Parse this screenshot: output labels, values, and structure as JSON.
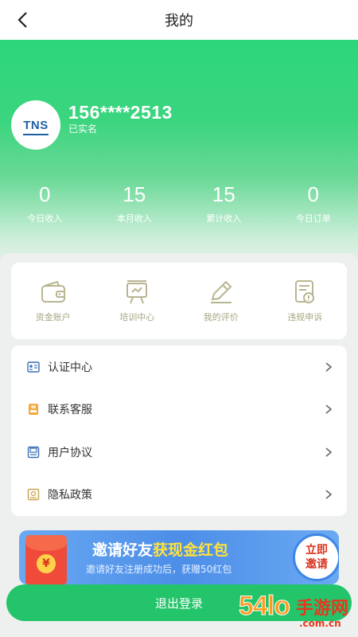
{
  "header": {
    "title": "我的",
    "back_icon": "chevron-left-icon"
  },
  "profile": {
    "avatar_logo": "TNS",
    "phone": "156****2513",
    "status": "已实名"
  },
  "stats": [
    {
      "value": "0",
      "label": "今日收入"
    },
    {
      "value": "15",
      "label": "本月收入"
    },
    {
      "value": "15",
      "label": "累计收入"
    },
    {
      "value": "0",
      "label": "今日订单"
    }
  ],
  "quick_actions": [
    {
      "label": "资金账户",
      "icon": "wallet-icon"
    },
    {
      "label": "培训中心",
      "icon": "easel-icon"
    },
    {
      "label": "我的评价",
      "icon": "pen-icon"
    },
    {
      "label": "违规申诉",
      "icon": "document-alert-icon"
    }
  ],
  "menu": [
    {
      "label": "认证中心",
      "icon": "id-card-icon"
    },
    {
      "label": "联系客服",
      "icon": "customer-service-icon"
    },
    {
      "label": "用户协议",
      "icon": "agreement-icon"
    },
    {
      "label": "隐私政策",
      "icon": "privacy-icon"
    }
  ],
  "banner": {
    "title_part1": "邀请好友",
    "title_part2": "获现金红包",
    "subtitle": "邀请好友注册成功后，获赠50红包",
    "cta_line1": "立即",
    "cta_line2": "邀请",
    "envelope_symbol": "¥"
  },
  "logout_label": "退出登录",
  "watermark": {
    "big": "54lo",
    "cn": "手游网",
    "url": ".com.cn"
  },
  "colors": {
    "primary_green": "#24c46a",
    "accent_text": "#a9a684",
    "banner_blue": "#4c8ee8",
    "highlight_yellow": "#ffe23a"
  }
}
